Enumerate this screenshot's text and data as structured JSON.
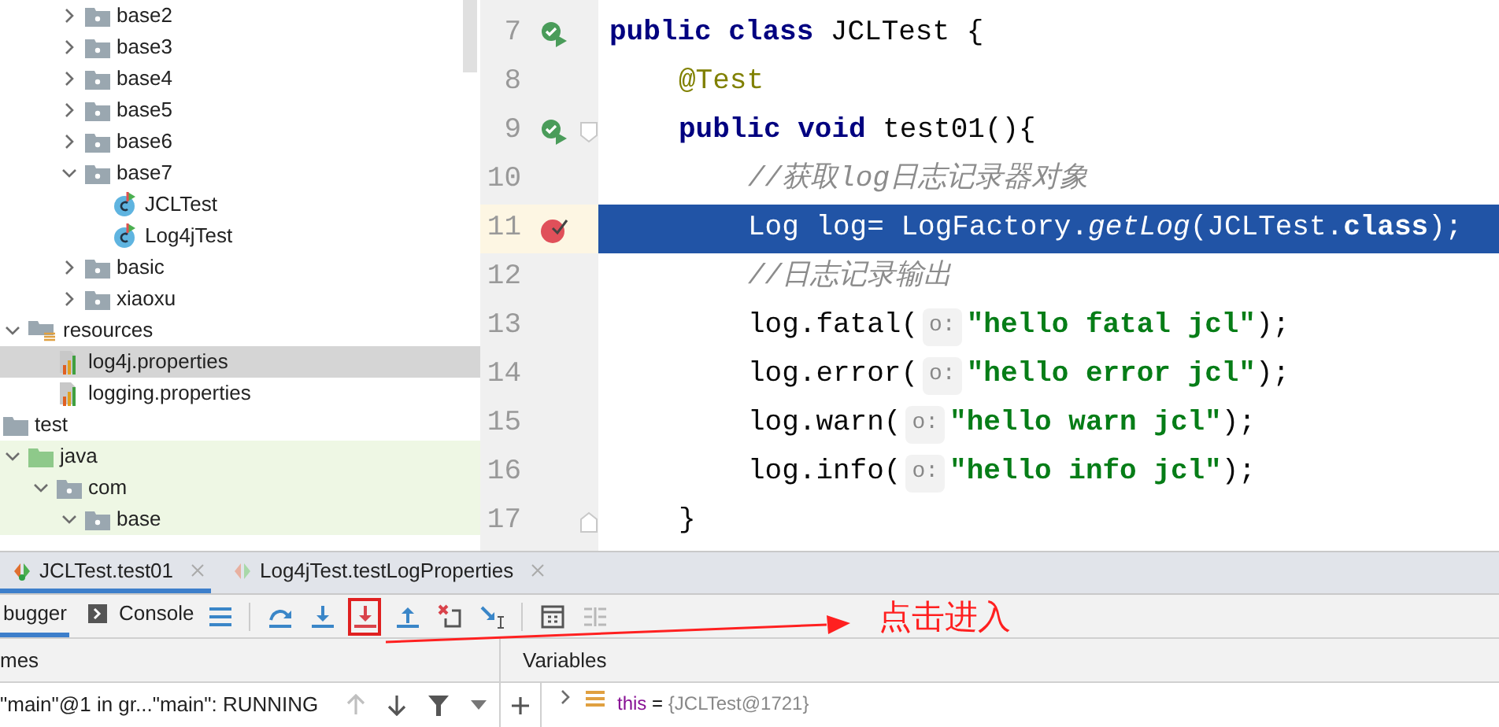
{
  "project_tree": {
    "top_items": [
      {
        "label": "base2",
        "kind": "package",
        "expanded": false,
        "selected": false
      },
      {
        "label": "base3",
        "kind": "package",
        "expanded": false,
        "selected": false
      },
      {
        "label": "base4",
        "kind": "package",
        "expanded": false,
        "selected": false
      },
      {
        "label": "base5",
        "kind": "package",
        "expanded": false,
        "selected": false
      },
      {
        "label": "base6",
        "kind": "package",
        "expanded": false,
        "selected": false
      },
      {
        "label": "base7",
        "kind": "package",
        "expanded": true,
        "selected": false,
        "children": [
          {
            "label": "JCLTest",
            "kind": "test-class",
            "selected": false
          },
          {
            "label": "Log4jTest",
            "kind": "test-class",
            "selected": false
          }
        ]
      },
      {
        "label": "basic",
        "kind": "package",
        "expanded": false,
        "selected": false
      },
      {
        "label": "xiaoxu",
        "kind": "package",
        "expanded": false,
        "selected": false
      }
    ],
    "items": [
      {
        "label": "resources",
        "kind": "resources",
        "expanded": true,
        "selected": false,
        "children": [
          {
            "label": "log4j.properties",
            "kind": "properties",
            "selected": true
          },
          {
            "label": "logging.properties",
            "kind": "properties",
            "selected": false
          }
        ]
      },
      {
        "label": "test",
        "kind": "plain-folder",
        "selected": false
      },
      {
        "label": "java",
        "kind": "test-root",
        "expanded": true,
        "selected": false,
        "children": [
          {
            "label": "com",
            "kind": "package",
            "expanded": true,
            "selected": false,
            "children": [
              {
                "label": "base",
                "kind": "package",
                "expanded": true,
                "selected": false
              }
            ]
          }
        ]
      }
    ]
  },
  "editor": {
    "lines": [
      {
        "number": "7",
        "kind": "class-level",
        "run_icon": true,
        "selected": false,
        "tokens": [
          {
            "kind": "keyword",
            "text": "public class"
          },
          {
            "kind": "plain",
            "text": " JCLTest {"
          }
        ]
      },
      {
        "number": "8",
        "kind": "member",
        "selected": false,
        "tokens": [
          {
            "kind": "annotation",
            "text": "@Test"
          }
        ]
      },
      {
        "number": "9",
        "kind": "member",
        "run_icon": true,
        "fold_start": true,
        "selected": false,
        "tokens": [
          {
            "kind": "keyword",
            "text": "public void"
          },
          {
            "kind": "plain",
            "text": " test01(){"
          }
        ]
      },
      {
        "number": "10",
        "kind": "statement",
        "selected": false,
        "tokens": [
          {
            "kind": "comment",
            "text": "//获取log日志记录器对象"
          }
        ]
      },
      {
        "number": "11",
        "kind": "statement",
        "breakpoint": true,
        "selected": true,
        "tokens": [
          {
            "kind": "plain",
            "text": "Log log= LogFactory."
          },
          {
            "kind": "method",
            "text": "getLog"
          },
          {
            "kind": "plain",
            "text": "(JCLTest."
          },
          {
            "kind": "keyword",
            "text": "class"
          },
          {
            "kind": "plain",
            "text": ");"
          }
        ]
      },
      {
        "number": "12",
        "kind": "statement",
        "selected": false,
        "tokens": [
          {
            "kind": "comment",
            "text": "//日志记录输出"
          }
        ]
      },
      {
        "number": "13",
        "kind": "statement",
        "selected": false,
        "tokens": [
          {
            "kind": "plain",
            "text": "log.fatal("
          },
          {
            "kind": "hint",
            "text": "o:"
          },
          {
            "kind": "string",
            "text": "\"hello fatal jcl\""
          },
          {
            "kind": "plain",
            "text": ");"
          }
        ]
      },
      {
        "number": "14",
        "kind": "statement",
        "selected": false,
        "tokens": [
          {
            "kind": "plain",
            "text": "log.error("
          },
          {
            "kind": "hint",
            "text": "o:"
          },
          {
            "kind": "string",
            "text": "\"hello error jcl\""
          },
          {
            "kind": "plain",
            "text": ");"
          }
        ]
      },
      {
        "number": "15",
        "kind": "statement",
        "selected": false,
        "tokens": [
          {
            "kind": "plain",
            "text": "log.warn("
          },
          {
            "kind": "hint",
            "text": "o:"
          },
          {
            "kind": "string",
            "text": "\"hello warn jcl\""
          },
          {
            "kind": "plain",
            "text": ");"
          }
        ]
      },
      {
        "number": "16",
        "kind": "statement",
        "selected": false,
        "tokens": [
          {
            "kind": "plain",
            "text": "log.info("
          },
          {
            "kind": "hint",
            "text": "o:"
          },
          {
            "kind": "string",
            "text": "\"hello info jcl\""
          },
          {
            "kind": "plain",
            "text": ");"
          }
        ]
      },
      {
        "number": "17",
        "kind": "member",
        "fold_end": true,
        "selected": false,
        "tokens": [
          {
            "kind": "plain",
            "text": "}"
          }
        ]
      }
    ]
  },
  "debug_panel": {
    "run_tabs": [
      {
        "label": "JCLTest.test01",
        "selected": true
      },
      {
        "label": "Log4jTest.testLogProperties",
        "selected": false
      }
    ],
    "view_tabs": [
      {
        "label": "bugger",
        "kind": "debugger",
        "selected": true
      },
      {
        "label": "Console",
        "kind": "console",
        "selected": false
      }
    ],
    "toolbar": [
      {
        "kind": "menu",
        "highlighted": false
      },
      {
        "kind": "step-over",
        "highlighted": false
      },
      {
        "kind": "step-into",
        "highlighted": false
      },
      {
        "kind": "force-step-into",
        "highlighted": true
      },
      {
        "kind": "step-out",
        "highlighted": false
      },
      {
        "kind": "drop-frame",
        "highlighted": false
      },
      {
        "kind": "run-to-cursor",
        "highlighted": false
      },
      {
        "kind": "evaluate",
        "highlighted": false
      },
      {
        "kind": "trace",
        "highlighted": false
      }
    ],
    "frames": {
      "header": "mes",
      "thread": "\"main\"@1 in gr...\"main\": RUNNING"
    },
    "variables": {
      "header": "Variables",
      "rows": [
        {
          "name": "this",
          "equals": "=",
          "value": "{JCLTest@1721}"
        }
      ]
    }
  },
  "annotation": {
    "text": "点击进入"
  }
}
